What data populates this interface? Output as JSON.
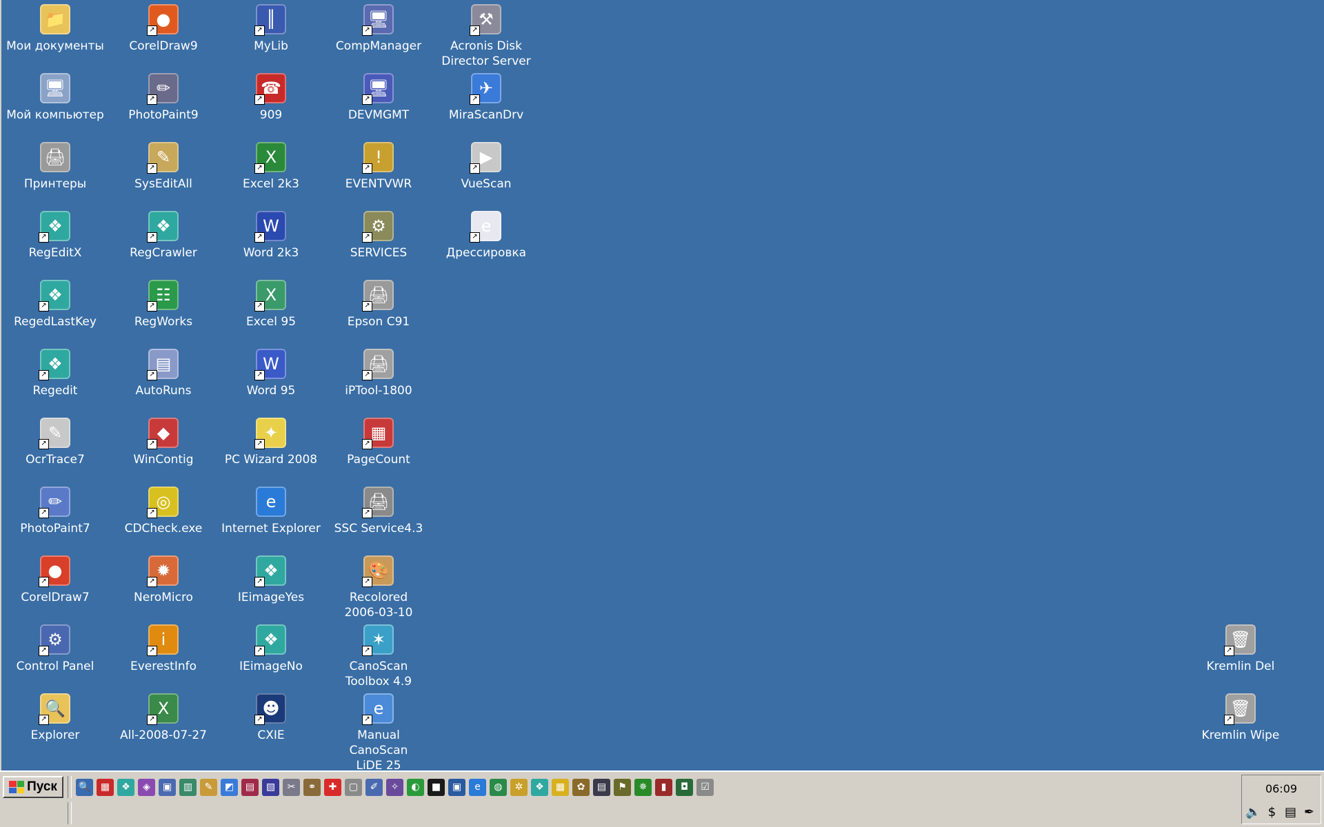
{
  "desktop": {
    "columns": [
      [
        {
          "label": "Мои документы",
          "icon": "my-documents-icon",
          "glyph": "📁",
          "color": "#e8c35a",
          "shortcut": false
        },
        {
          "label": "Мой компьютер",
          "icon": "my-computer-icon",
          "glyph": "🖥",
          "color": "#8aa2c8",
          "shortcut": false
        },
        {
          "label": "Принтеры",
          "icon": "printers-icon",
          "glyph": "🖨",
          "color": "#9a9a9a",
          "shortcut": false
        },
        {
          "label": "RegEditX",
          "icon": "regeditx-icon",
          "glyph": "❖",
          "color": "#2fa8a0",
          "shortcut": true
        },
        {
          "label": "RegedLastKey",
          "icon": "regedlastkey-icon",
          "glyph": "❖",
          "color": "#2fa8a0",
          "shortcut": true
        },
        {
          "label": "Regedit",
          "icon": "regedit-icon",
          "glyph": "❖",
          "color": "#2fa8a0",
          "shortcut": true
        },
        {
          "label": "OcrTrace7",
          "icon": "ocrtrace7-icon",
          "glyph": "✎",
          "color": "#c8c8c8",
          "shortcut": true
        },
        {
          "label": "PhotoPaint7",
          "icon": "photopaint7-icon",
          "glyph": "✏",
          "color": "#5a7ac8",
          "shortcut": true
        },
        {
          "label": "CorelDraw7",
          "icon": "coreldraw7-icon",
          "glyph": "●",
          "color": "#d8402a",
          "shortcut": true
        },
        {
          "label": "Control Panel",
          "icon": "control-panel-icon",
          "glyph": "⚙",
          "color": "#4a68b0",
          "shortcut": true
        },
        {
          "label": "Explorer",
          "icon": "explorer-icon",
          "glyph": "🔍",
          "color": "#e8c35a",
          "shortcut": true
        }
      ],
      [
        {
          "label": "CorelDraw9",
          "icon": "coreldraw9-icon",
          "glyph": "●",
          "color": "#e05a20",
          "shortcut": true
        },
        {
          "label": "PhotoPaint9",
          "icon": "photopaint9-icon",
          "glyph": "✏",
          "color": "#6a6a8a",
          "shortcut": true
        },
        {
          "label": "SysEditAll",
          "icon": "syseditall-icon",
          "glyph": "✎",
          "color": "#c8a85a",
          "shortcut": true
        },
        {
          "label": "RegCrawler",
          "icon": "regcrawler-icon",
          "glyph": "❖",
          "color": "#2fa8a0",
          "shortcut": true
        },
        {
          "label": "RegWorks",
          "icon": "regworks-icon",
          "glyph": "☷",
          "color": "#2a9a4a",
          "shortcut": true
        },
        {
          "label": "AutoRuns",
          "icon": "autoruns-icon",
          "glyph": "▤",
          "color": "#8a9ac8",
          "shortcut": true
        },
        {
          "label": "WinContig",
          "icon": "wincontig-icon",
          "glyph": "◆",
          "color": "#c83a3a",
          "shortcut": true
        },
        {
          "label": "CDCheck.exe",
          "icon": "cdcheck-icon",
          "glyph": "◎",
          "color": "#d8c020",
          "shortcut": true
        },
        {
          "label": "NeroMicro",
          "icon": "neromicro-icon",
          "glyph": "✹",
          "color": "#d86a3a",
          "shortcut": true
        },
        {
          "label": "EverestInfo",
          "icon": "everestinfo-icon",
          "glyph": "i",
          "color": "#e08a10",
          "shortcut": true
        },
        {
          "label": "All-2008-07-27",
          "icon": "excel-file-icon",
          "glyph": "X",
          "color": "#3a8a4a",
          "shortcut": true
        }
      ],
      [
        {
          "label": "MyLib",
          "icon": "mylib-icon",
          "glyph": "║",
          "color": "#3a5ab0",
          "shortcut": true
        },
        {
          "label": "909",
          "icon": "phone-909-icon",
          "glyph": "☎",
          "color": "#c82a2a",
          "shortcut": true
        },
        {
          "label": "Excel 2k3",
          "icon": "excel-2k3-icon",
          "glyph": "X",
          "color": "#2a8a3a",
          "shortcut": true
        },
        {
          "label": "Word 2k3",
          "icon": "word-2k3-icon",
          "glyph": "W",
          "color": "#2a4ab0",
          "shortcut": true
        },
        {
          "label": "Excel 95",
          "icon": "excel-95-icon",
          "glyph": "X",
          "color": "#3a9a6a",
          "shortcut": true
        },
        {
          "label": "Word 95",
          "icon": "word-95-icon",
          "glyph": "W",
          "color": "#3a5ac8",
          "shortcut": true
        },
        {
          "label": "PC Wizard 2008",
          "icon": "pc-wizard-icon",
          "glyph": "✦",
          "color": "#e8d04a",
          "shortcut": true
        },
        {
          "label": "Internet Explorer",
          "icon": "internet-explorer-icon",
          "glyph": "e",
          "color": "#2a7ad8",
          "shortcut": false
        },
        {
          "label": "IEimageYes",
          "icon": "ieimageyes-icon",
          "glyph": "❖",
          "color": "#2fa8a0",
          "shortcut": true
        },
        {
          "label": "IEimageNo",
          "icon": "ieimageno-icon",
          "glyph": "❖",
          "color": "#2fa8a0",
          "shortcut": true
        },
        {
          "label": "CXIE",
          "icon": "cxie-icon",
          "glyph": "☻",
          "color": "#1a3a7a",
          "shortcut": true
        }
      ],
      [
        {
          "label": "CompManager",
          "icon": "compmanager-icon",
          "glyph": "🖥",
          "color": "#5a6ab0",
          "shortcut": true
        },
        {
          "label": "DEVMGMT",
          "icon": "devmgmt-icon",
          "glyph": "🖥",
          "color": "#4a5ab8",
          "shortcut": true
        },
        {
          "label": "EVENTVWR",
          "icon": "eventvwr-icon",
          "glyph": "!",
          "color": "#c8a030",
          "shortcut": true
        },
        {
          "label": "SERVICES",
          "icon": "services-icon",
          "glyph": "⚙",
          "color": "#8a8a5a",
          "shortcut": true
        },
        {
          "label": "Epson C91",
          "icon": "epson-c91-icon",
          "glyph": "🖨",
          "color": "#9a9a9a",
          "shortcut": true
        },
        {
          "label": "iPTool-1800",
          "icon": "iptool-icon",
          "glyph": "🖨",
          "color": "#a0a0a0",
          "shortcut": true
        },
        {
          "label": "PageCount",
          "icon": "pagecount-icon",
          "glyph": "▦",
          "color": "#c83a3a",
          "shortcut": true
        },
        {
          "label": "SSC Service4.3",
          "icon": "ssc-service-icon",
          "glyph": "🖨",
          "color": "#8a8a8a",
          "shortcut": true
        },
        {
          "label": "Recolored\n2006-03-10",
          "icon": "recolored-icon",
          "glyph": "🎨",
          "color": "#c89a5a",
          "shortcut": true
        },
        {
          "label": "CanoScan\nToolbox 4.9",
          "icon": "canoscan-toolbox-icon",
          "glyph": "✶",
          "color": "#3aa0c8",
          "shortcut": true
        },
        {
          "label": "Manual CanoScan\nLiDE 25",
          "icon": "manual-canoscan-icon",
          "glyph": "e",
          "color": "#4a8ad8",
          "shortcut": true
        }
      ],
      [
        {
          "label": "Acronis Disk\nDirector Server",
          "icon": "acronis-icon",
          "glyph": "⚒",
          "color": "#8a8a9a",
          "shortcut": true
        },
        {
          "label": "MiraScanDrv",
          "icon": "mirascandrv-icon",
          "glyph": "✈",
          "color": "#3a7ad8",
          "shortcut": true
        },
        {
          "label": "VueScan",
          "icon": "vuescan-icon",
          "glyph": "▶",
          "color": "#c8c8c8",
          "shortcut": true
        },
        {
          "label": "Дрессировка",
          "icon": "web-document-icon",
          "glyph": "e",
          "color": "#e8e8f0",
          "shortcut": true
        }
      ]
    ],
    "right_icons": [
      {
        "label": "Kremlin Del",
        "icon": "kremlin-del-icon",
        "glyph": "🗑",
        "color": "#a0a0a0",
        "shortcut": true
      },
      {
        "label": "Kremlin Wipe",
        "icon": "kremlin-wipe-icon",
        "glyph": "🗑",
        "color": "#a0a0a0",
        "shortcut": true
      }
    ]
  },
  "taskbar": {
    "start_label": "Пуск",
    "quick_launch": [
      {
        "icon": "search-icon",
        "glyph": "🔍",
        "color": "#3a6ab0"
      },
      {
        "icon": "registry-icon",
        "glyph": "▦",
        "color": "#c82a2a"
      },
      {
        "icon": "regedit-icon",
        "glyph": "❖",
        "color": "#2fa8a0"
      },
      {
        "icon": "package-icon",
        "glyph": "◈",
        "color": "#8a4ab0"
      },
      {
        "icon": "monitor-icon",
        "glyph": "▣",
        "color": "#4a6ab0"
      },
      {
        "icon": "book-icon",
        "glyph": "▥",
        "color": "#3a8a6a"
      },
      {
        "icon": "pen-icon",
        "glyph": "✎",
        "color": "#c89a3a"
      },
      {
        "icon": "eraser-icon",
        "glyph": "◩",
        "color": "#3a7ad8"
      },
      {
        "icon": "books-icon",
        "glyph": "▤",
        "color": "#a02a4a"
      },
      {
        "icon": "notebook-icon",
        "glyph": "▧",
        "color": "#3a3a9a"
      },
      {
        "icon": "tools-icon",
        "glyph": "✂",
        "color": "#7a7a8a"
      },
      {
        "icon": "tape-icon",
        "glyph": "⚭",
        "color": "#8a6a3a"
      },
      {
        "icon": "first-aid-icon",
        "glyph": "✚",
        "color": "#d82a2a"
      },
      {
        "icon": "document-icon",
        "glyph": "▢",
        "color": "#8a8a8a"
      },
      {
        "icon": "edit-icon",
        "glyph": "✐",
        "color": "#4a6ab0"
      },
      {
        "icon": "wand-icon",
        "glyph": "✧",
        "color": "#6a4a9a"
      },
      {
        "icon": "chart-icon",
        "glyph": "◐",
        "color": "#2a9a3a"
      },
      {
        "icon": "colors-icon",
        "glyph": "■",
        "color": "#1a1a1a"
      },
      {
        "icon": "image-icon",
        "glyph": "▣",
        "color": "#2a5aa0"
      },
      {
        "icon": "ie-icon",
        "glyph": "e",
        "color": "#2a7ad8"
      },
      {
        "icon": "globe-icon",
        "glyph": "◍",
        "color": "#2a8a4a"
      },
      {
        "icon": "puzzle-icon",
        "glyph": "✲",
        "color": "#c8a02a"
      },
      {
        "icon": "registry2-icon",
        "glyph": "❖",
        "color": "#2fa8a0"
      },
      {
        "icon": "grid-icon",
        "glyph": "▦",
        "color": "#d8b020"
      },
      {
        "icon": "palette-icon",
        "glyph": "✿",
        "color": "#8a6a2a"
      },
      {
        "icon": "keyboard-icon",
        "glyph": "▤",
        "color": "#3a3a4a"
      },
      {
        "icon": "flag-icon",
        "glyph": "⚑",
        "color": "#6a6a2a"
      },
      {
        "icon": "network-icon",
        "glyph": "✵",
        "color": "#2a8a2a"
      },
      {
        "icon": "archive-icon",
        "glyph": "▮",
        "color": "#9a2a2a"
      },
      {
        "icon": "drive-icon",
        "glyph": "◘",
        "color": "#2a6a3a"
      },
      {
        "icon": "checklist-icon",
        "glyph": "☑",
        "color": "#8a8a8a"
      }
    ],
    "clock": "06:09",
    "tray": [
      {
        "icon": "volume-icon",
        "glyph": "🔈"
      },
      {
        "icon": "antivirus-icon",
        "glyph": "$"
      },
      {
        "icon": "language-flag-icon",
        "glyph": "▤"
      },
      {
        "icon": "pen-tray-icon",
        "glyph": "✒"
      }
    ]
  }
}
